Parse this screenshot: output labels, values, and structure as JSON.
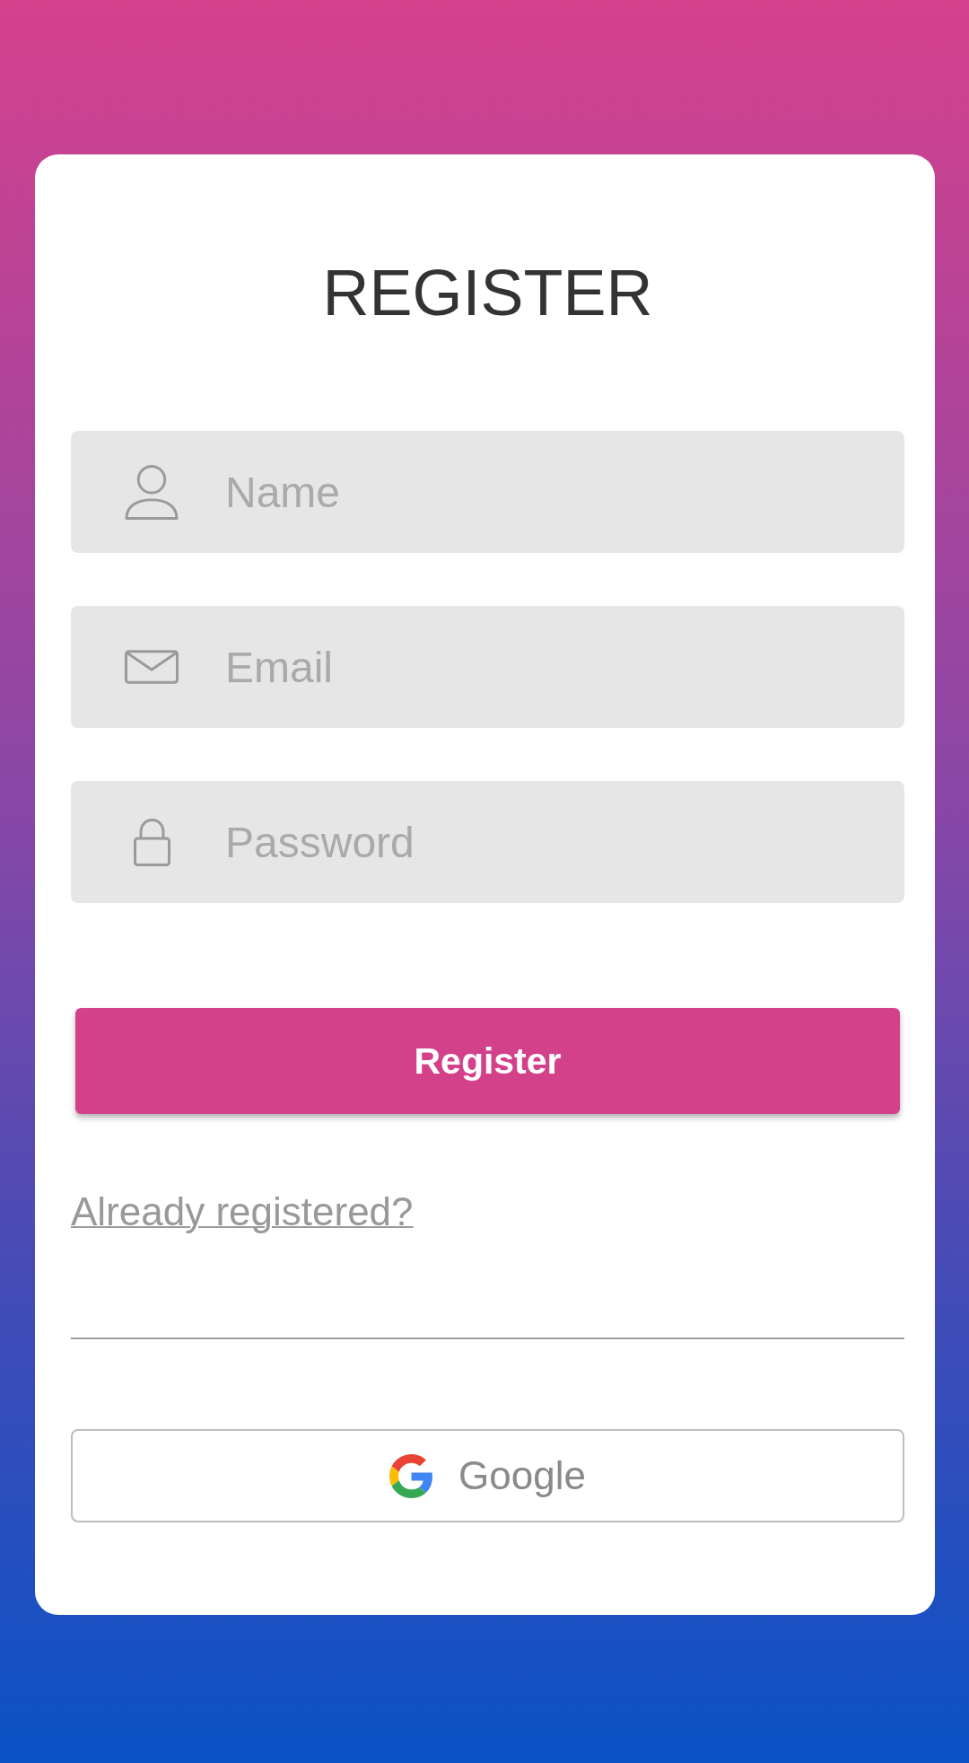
{
  "title": "REGISTER",
  "fields": [
    {
      "kind": "name",
      "placeholder": "Name"
    },
    {
      "kind": "email",
      "placeholder": "Email"
    },
    {
      "kind": "password",
      "placeholder": "Password"
    }
  ],
  "submit_button": "Register",
  "login_link": "Already registered?",
  "social_buttons": [
    {
      "kind": "google",
      "label": "Google"
    }
  ]
}
